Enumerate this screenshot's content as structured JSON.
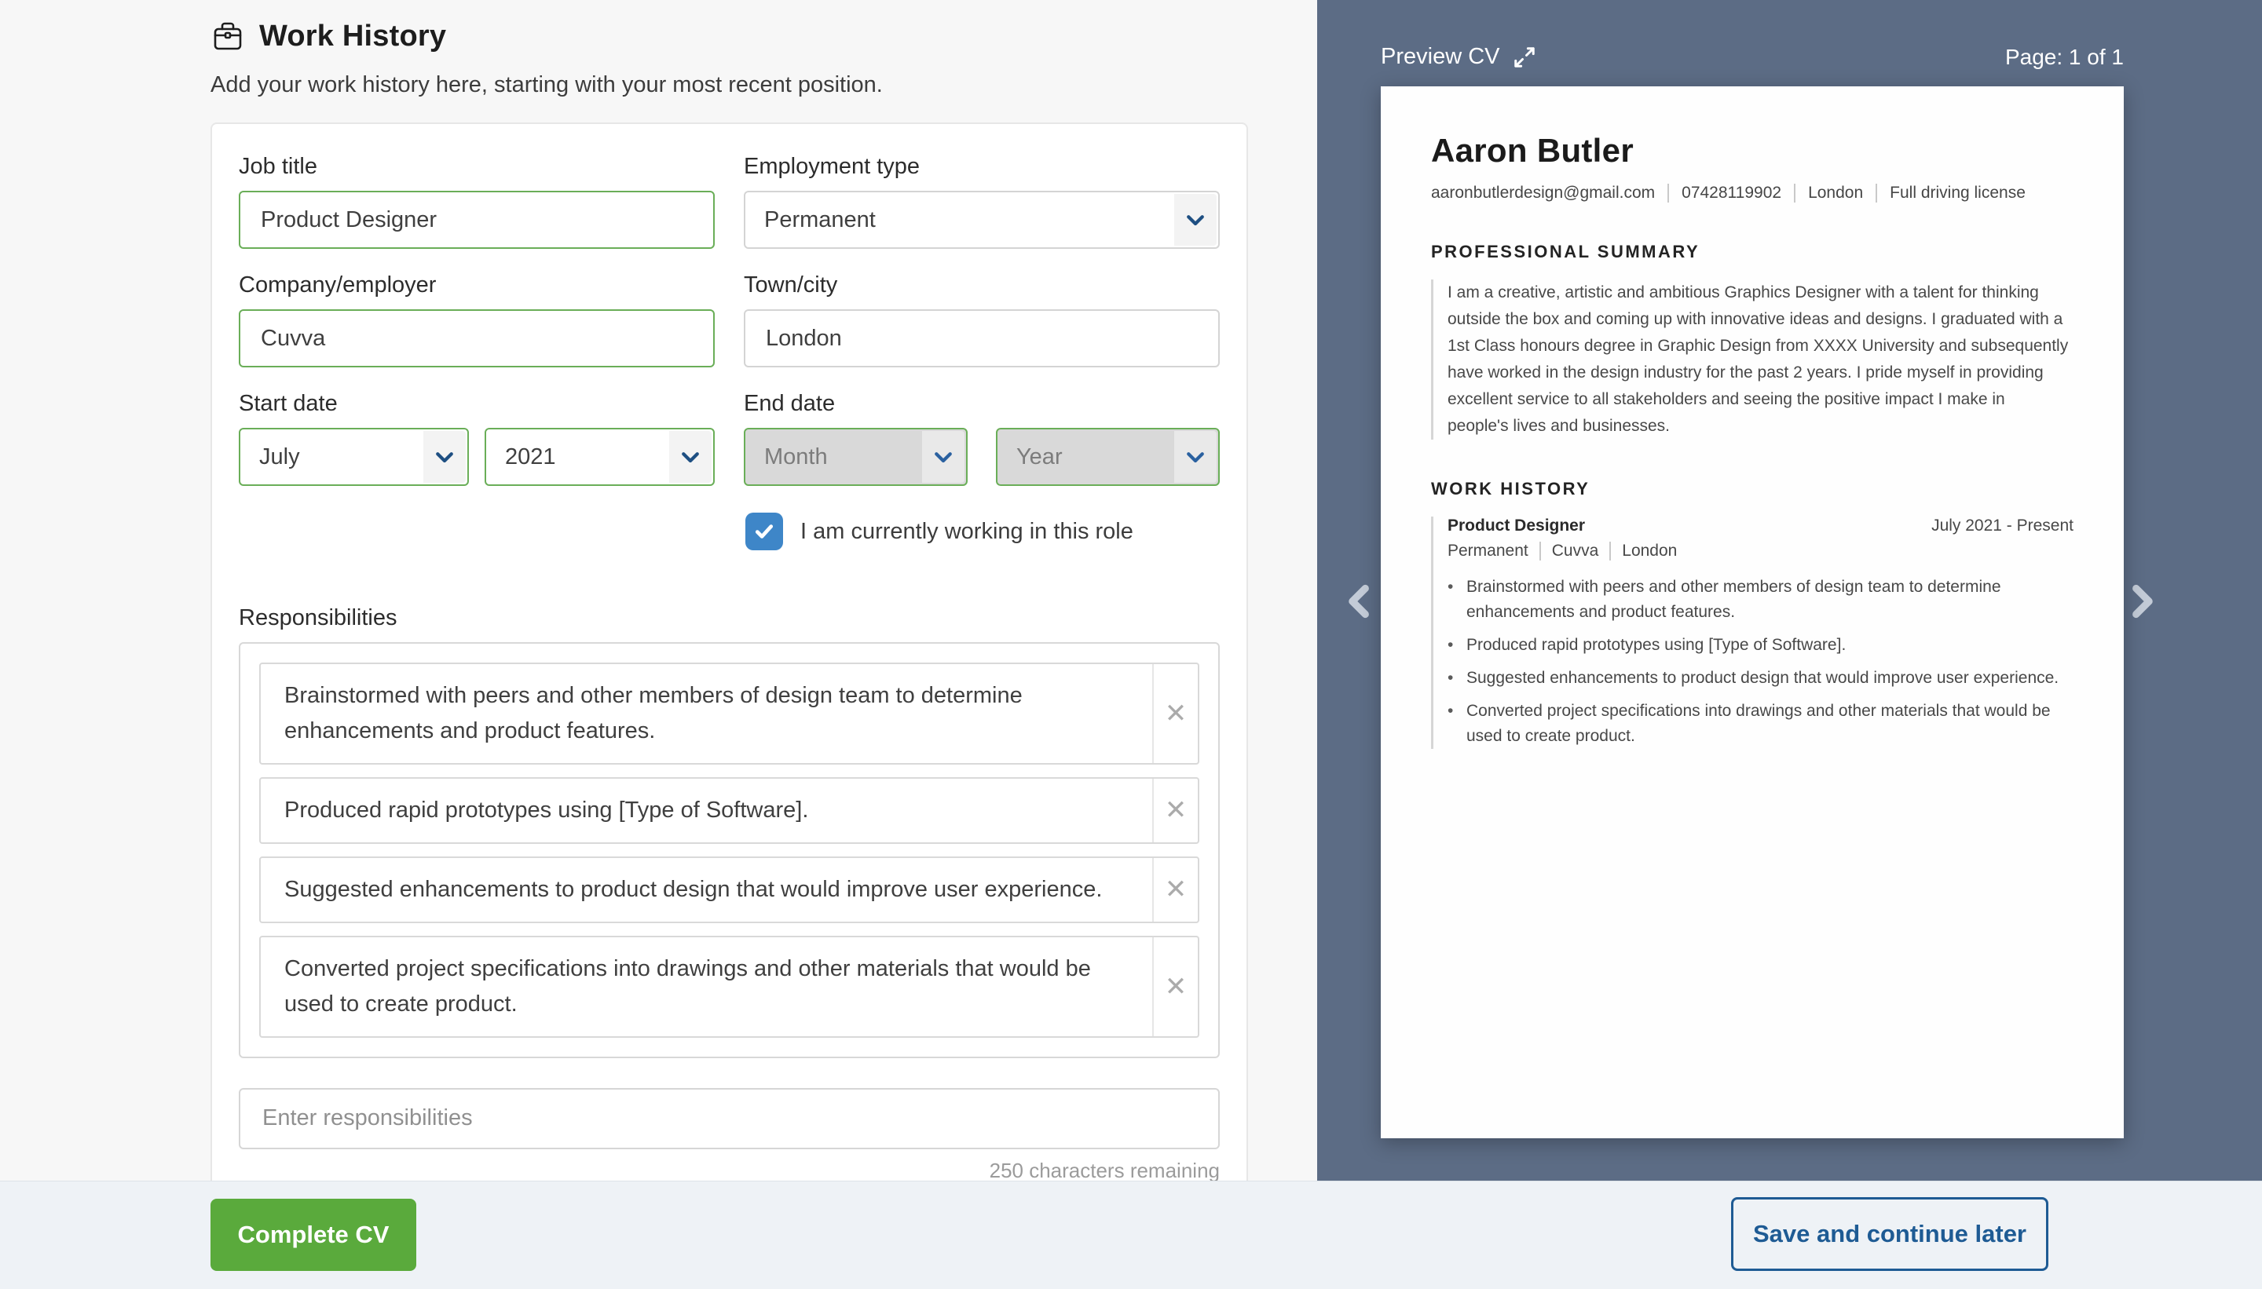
{
  "header": {
    "title": "Work History",
    "subtitle": "Add your work history here, starting with your most recent position."
  },
  "form": {
    "job_title": {
      "label": "Job title",
      "value": "Product Designer"
    },
    "employment_type": {
      "label": "Employment type",
      "value": "Permanent"
    },
    "company": {
      "label": "Company/employer",
      "value": "Cuvva"
    },
    "town": {
      "label": "Town/city",
      "value": "London"
    },
    "start_date": {
      "label": "Start date",
      "month": "July",
      "year": "2021"
    },
    "end_date": {
      "label": "End date",
      "month_placeholder": "Month",
      "year_placeholder": "Year"
    },
    "current_role_label": "I am currently working in this role",
    "responsibilities": {
      "label": "Responsibilities",
      "items": [
        "Brainstormed with peers and other members of design team to determine enhancements and product features.",
        "Produced rapid prototypes using [Type of Software].",
        "Suggested enhancements to product design that would improve user experience.",
        "Converted project specifications into drawings and other materials that would be used to create product."
      ],
      "input_placeholder": "Enter responsibilities",
      "chars_remaining": "250 characters remaining"
    }
  },
  "footer": {
    "complete_label": "Complete CV",
    "save_label": "Save and continue later"
  },
  "preview": {
    "title": "Preview CV",
    "page_indicator": "Page: 1 of 1",
    "cv": {
      "name": "Aaron Butler",
      "contact": [
        "aaronbutlerdesign@gmail.com",
        "07428119902",
        "London",
        "Full driving license"
      ],
      "summary_heading": "PROFESSIONAL SUMMARY",
      "summary": "I am a creative, artistic and ambitious Graphics Designer with a talent for thinking outside the box and coming up with innovative ideas and designs. I graduated with a 1st Class honours degree in Graphic Design from XXXX University and subsequently have worked in the design industry for the past 2 years. I pride myself in providing excellent service to all stakeholders and seeing the positive impact I make in people's lives and businesses.",
      "work_heading": "WORK HISTORY",
      "job": {
        "title": "Product Designer",
        "dates": "July 2021 - Present",
        "meta": [
          "Permanent",
          "Cuvva",
          "London"
        ],
        "bullets": [
          "Brainstormed with peers and other members of design team to determine enhancements and product features.",
          "Produced rapid prototypes using [Type of Software].",
          "Suggested enhancements to product design that would improve user experience.",
          "Converted project specifications into drawings and other materials that would be used to create product."
        ]
      }
    }
  },
  "icons": {
    "close": "✕"
  },
  "colors": {
    "accent_green": "#6aae58",
    "button_green": "#5aaa3c",
    "action_blue": "#1e5b94",
    "checkbox_blue": "#3e86c8",
    "panel_slate": "#5c6c85",
    "footer_bg": "#eef2f6"
  }
}
